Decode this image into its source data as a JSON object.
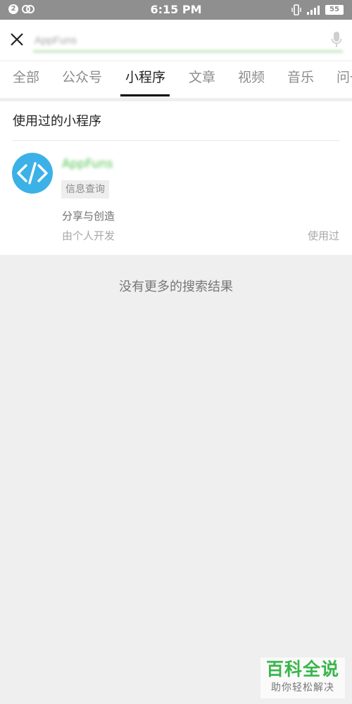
{
  "status_bar": {
    "notification_count": "2",
    "time": "6:15 PM",
    "battery": "55"
  },
  "search": {
    "query": "AppFuns"
  },
  "tabs": [
    {
      "label": "全部"
    },
    {
      "label": "公众号"
    },
    {
      "label": "小程序",
      "active": true
    },
    {
      "label": "文章"
    },
    {
      "label": "视频"
    },
    {
      "label": "音乐"
    },
    {
      "label": "问一"
    }
  ],
  "results": {
    "section_title": "使用过的小程序",
    "items": [
      {
        "icon": "code-brackets-icon",
        "icon_color": "#3bb1e8",
        "name": "AppFuns",
        "tag": "信息查询",
        "description": "分享与创造",
        "developer": "由个人开发",
        "status": "使用过"
      }
    ]
  },
  "no_more_text": "没有更多的搜索结果",
  "watermark": {
    "title": "百科全说",
    "subtitle": "助你轻松解决"
  },
  "colors": {
    "status_bar": "#8f8f8f",
    "accent_green": "#9ad28c",
    "icon_blue": "#3bb1e8",
    "watermark_green": "#38b64a"
  }
}
